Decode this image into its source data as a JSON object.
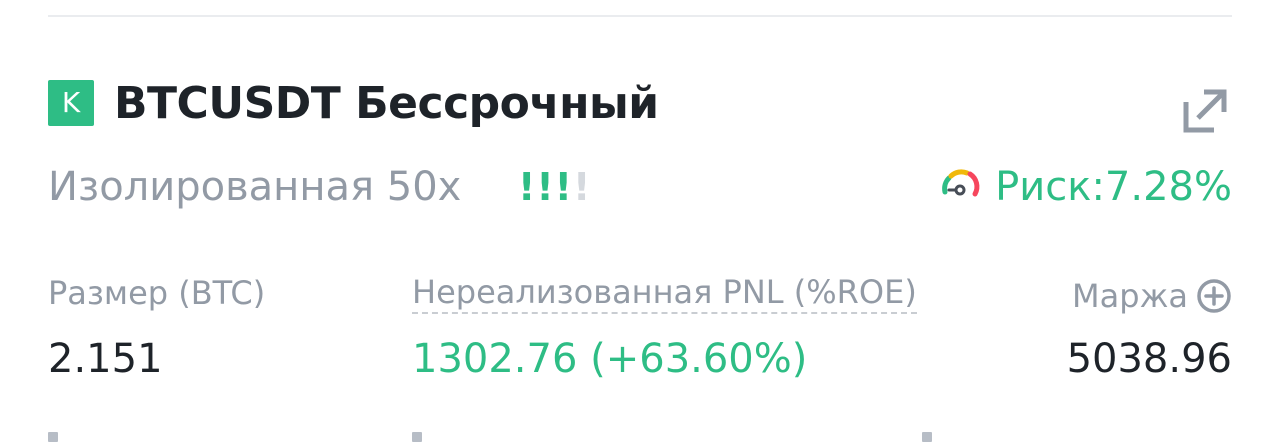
{
  "position": {
    "badge": "K",
    "symbol": "BTCUSDT Бессрочный",
    "margin_type": "Изолированная 50x",
    "strength": {
      "active": "!!!",
      "inactive": "!"
    },
    "risk_label": "Риск:7.28%"
  },
  "metrics": {
    "size": {
      "label": "Размер (BTC)",
      "value": "2.151"
    },
    "pnl": {
      "label": "Нереализованная PNL (%ROE)",
      "value": "1302.76 (+63.60%)"
    },
    "margin": {
      "label": "Маржа",
      "value": "5038.96"
    }
  },
  "icons": {
    "share": "share-external-icon",
    "risk": "risk-gauge-icon",
    "add_margin": "plus-circle-icon"
  },
  "colors": {
    "positive": "#2ebd85",
    "muted": "#929aa5",
    "text": "#1e2329",
    "risk_red": "#f6465d",
    "risk_yellow": "#f0b90b"
  }
}
